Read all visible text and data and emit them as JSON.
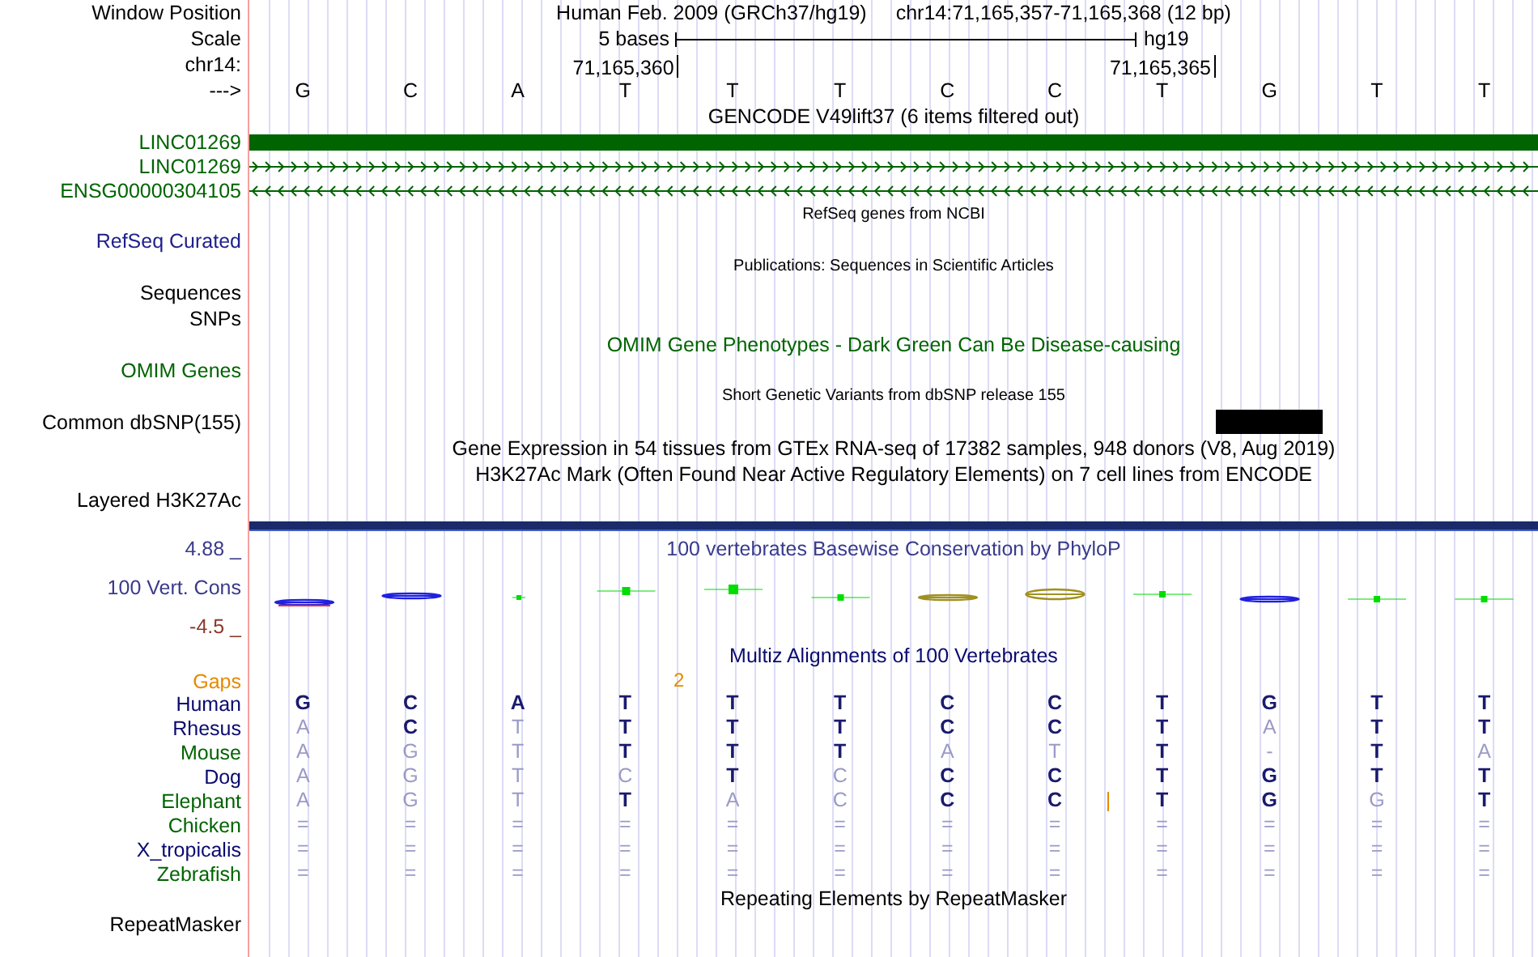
{
  "position": {
    "label": "Window Position",
    "assembly": "Human Feb. 2009 (GRCh37/hg19)",
    "range": "chr14:71,165,357-71,165,368 (12 bp)"
  },
  "scale": {
    "label": "Scale",
    "span": "5 bases",
    "db": "hg19"
  },
  "ruler": {
    "chrom_label": "chr14:",
    "strand_label": "--->",
    "bases": [
      {
        "base": "G"
      },
      {
        "base": "C"
      },
      {
        "base": "A"
      },
      {
        "base": "T",
        "tick": "71,165,360"
      },
      {
        "base": "T"
      },
      {
        "base": "T"
      },
      {
        "base": "C"
      },
      {
        "base": "C"
      },
      {
        "base": "T",
        "tick": "71,165,365"
      },
      {
        "base": "G"
      },
      {
        "base": "T"
      },
      {
        "base": "T"
      }
    ]
  },
  "tracks": [
    {
      "kind": "title",
      "text": "GENCODE V49lift37 (6 items filtered out)",
      "color": "#000000"
    },
    {
      "kind": "gene_block",
      "label": "LINC01269",
      "color": "#006400"
    },
    {
      "kind": "gene_plus",
      "label": "LINC01269",
      "color": "#006400"
    },
    {
      "kind": "gene_minus",
      "label": "ENSG00000304105",
      "color": "#006400"
    },
    {
      "kind": "small_title",
      "text": "RefSeq genes from NCBI",
      "color": "#000000"
    },
    {
      "kind": "label",
      "label": "RefSeq Curated",
      "color": "#20208c"
    },
    {
      "kind": "small_title",
      "text": "Publications: Sequences in Scientific Articles",
      "color": "#000000"
    },
    {
      "kind": "label",
      "label": "Sequences",
      "color": "#000000"
    },
    {
      "kind": "label",
      "label": "SNPs",
      "color": "#000000"
    },
    {
      "kind": "title",
      "text": "OMIM Gene Phenotypes - Dark Green Can Be Disease-causing",
      "color": "#006400"
    },
    {
      "kind": "label",
      "label": "OMIM Genes",
      "color": "#006400"
    },
    {
      "kind": "small_title",
      "text": "Short Genetic Variants from dbSNP release 155",
      "color": "#000000"
    },
    {
      "kind": "variant",
      "label": "Common dbSNP(155)",
      "color": "#000000"
    },
    {
      "kind": "title",
      "text": "Gene Expression in 54 tissues from GTEx RNA-seq of 17382 samples, 948 donors (V8, Aug 2019)",
      "color": "#000000"
    },
    {
      "kind": "title",
      "text": "H3K27Ac Mark (Often Found Near Active Regulatory Elements) on 7 cell lines from ENCODE",
      "color": "#000000"
    },
    {
      "kind": "label",
      "label": "Layered H3K27Ac",
      "color": "#000000"
    },
    {
      "kind": "separator"
    },
    {
      "kind": "wiggle",
      "label": "100 Vert. Cons",
      "title": "100 vertebrates Basewise Conservation by PhyloP",
      "max": "4.88 _",
      "min": "-4.5 _",
      "color": "#3a3a8c"
    },
    {
      "kind": "title",
      "text": "Multiz Alignments of 100 Vertebrates",
      "color": "#0a0a6e"
    },
    {
      "kind": "gaps",
      "label": "Gaps",
      "marker": "2",
      "color": "#e68a00"
    },
    {
      "kind": "species",
      "label": "Human",
      "color": "#0a0a6e",
      "insertion": false,
      "bases": [
        {
          "base": "G",
          "match": true
        },
        {
          "base": "C",
          "match": true
        },
        {
          "base": "A",
          "match": true
        },
        {
          "base": "T",
          "match": true
        },
        {
          "base": "T",
          "match": true
        },
        {
          "base": "T",
          "match": true
        },
        {
          "base": "C",
          "match": true
        },
        {
          "base": "C",
          "match": true
        },
        {
          "base": "T",
          "match": true
        },
        {
          "base": "G",
          "match": true
        },
        {
          "base": "T",
          "match": true
        },
        {
          "base": "T",
          "match": true
        }
      ]
    },
    {
      "kind": "species",
      "label": "Rhesus",
      "color": "#0a0a6e",
      "insertion": false,
      "bases": [
        {
          "base": "A",
          "match": false
        },
        {
          "base": "C",
          "match": true
        },
        {
          "base": "T",
          "match": false
        },
        {
          "base": "T",
          "match": true
        },
        {
          "base": "T",
          "match": true
        },
        {
          "base": "T",
          "match": true
        },
        {
          "base": "C",
          "match": true
        },
        {
          "base": "C",
          "match": true
        },
        {
          "base": "T",
          "match": true
        },
        {
          "base": "A",
          "match": false
        },
        {
          "base": "T",
          "match": true
        },
        {
          "base": "T",
          "match": true
        }
      ]
    },
    {
      "kind": "species",
      "label": "Mouse",
      "color": "#006400",
      "insertion": false,
      "bases": [
        {
          "base": "A",
          "match": false
        },
        {
          "base": "G",
          "match": false
        },
        {
          "base": "T",
          "match": false
        },
        {
          "base": "T",
          "match": true
        },
        {
          "base": "T",
          "match": true
        },
        {
          "base": "T",
          "match": true
        },
        {
          "base": "A",
          "match": false
        },
        {
          "base": "T",
          "match": false
        },
        {
          "base": "T",
          "match": true
        },
        {
          "base": "-",
          "match": false
        },
        {
          "base": "T",
          "match": true
        },
        {
          "base": "A",
          "match": false
        }
      ]
    },
    {
      "kind": "species",
      "label": "Dog",
      "color": "#0a0a6e",
      "insertion": false,
      "bases": [
        {
          "base": "A",
          "match": false
        },
        {
          "base": "G",
          "match": false
        },
        {
          "base": "T",
          "match": false
        },
        {
          "base": "C",
          "match": false
        },
        {
          "base": "T",
          "match": true
        },
        {
          "base": "C",
          "match": false
        },
        {
          "base": "C",
          "match": true
        },
        {
          "base": "C",
          "match": true
        },
        {
          "base": "T",
          "match": true
        },
        {
          "base": "G",
          "match": true
        },
        {
          "base": "T",
          "match": true
        },
        {
          "base": "T",
          "match": true
        }
      ]
    },
    {
      "kind": "species",
      "label": "Elephant",
      "color": "#006400",
      "insertion": true,
      "bases": [
        {
          "base": "A",
          "match": false
        },
        {
          "base": "G",
          "match": false
        },
        {
          "base": "T",
          "match": false
        },
        {
          "base": "T",
          "match": true
        },
        {
          "base": "A",
          "match": false
        },
        {
          "base": "C",
          "match": false
        },
        {
          "base": "C",
          "match": true
        },
        {
          "base": "C",
          "match": true
        },
        {
          "base": "T",
          "match": true
        },
        {
          "base": "G",
          "match": true
        },
        {
          "base": "G",
          "match": false
        },
        {
          "base": "T",
          "match": true
        }
      ]
    },
    {
      "kind": "species",
      "label": "Chicken",
      "color": "#006400",
      "insertion": false,
      "bases": [
        {
          "base": "=",
          "match": false
        },
        {
          "base": "=",
          "match": false
        },
        {
          "base": "=",
          "match": false
        },
        {
          "base": "=",
          "match": false
        },
        {
          "base": "=",
          "match": false
        },
        {
          "base": "=",
          "match": false
        },
        {
          "base": "=",
          "match": false
        },
        {
          "base": "=",
          "match": false
        },
        {
          "base": "=",
          "match": false
        },
        {
          "base": "=",
          "match": false
        },
        {
          "base": "=",
          "match": false
        },
        {
          "base": "=",
          "match": false
        }
      ]
    },
    {
      "kind": "species",
      "label": "X_tropicalis",
      "color": "#0a0a6e",
      "insertion": false,
      "bases": [
        {
          "base": "=",
          "match": false
        },
        {
          "base": "=",
          "match": false
        },
        {
          "base": "=",
          "match": false
        },
        {
          "base": "=",
          "match": false
        },
        {
          "base": "=",
          "match": false
        },
        {
          "base": "=",
          "match": false
        },
        {
          "base": "=",
          "match": false
        },
        {
          "base": "=",
          "match": false
        },
        {
          "base": "=",
          "match": false
        },
        {
          "base": "=",
          "match": false
        },
        {
          "base": "=",
          "match": false
        },
        {
          "base": "=",
          "match": false
        }
      ]
    },
    {
      "kind": "species",
      "label": "Zebrafish",
      "color": "#006400",
      "insertion": false,
      "bases": [
        {
          "base": "=",
          "match": false
        },
        {
          "base": "=",
          "match": false
        },
        {
          "base": "=",
          "match": false
        },
        {
          "base": "=",
          "match": false
        },
        {
          "base": "=",
          "match": false
        },
        {
          "base": "=",
          "match": false
        },
        {
          "base": "=",
          "match": false
        },
        {
          "base": "=",
          "match": false
        },
        {
          "base": "=",
          "match": false
        },
        {
          "base": "=",
          "match": false
        },
        {
          "base": "=",
          "match": false
        },
        {
          "base": "=",
          "match": false
        }
      ]
    },
    {
      "kind": "title",
      "text": "Repeating Elements by RepeatMasker",
      "color": "#000000"
    },
    {
      "kind": "label",
      "label": "RepeatMasker",
      "color": "#000000"
    }
  ]
}
